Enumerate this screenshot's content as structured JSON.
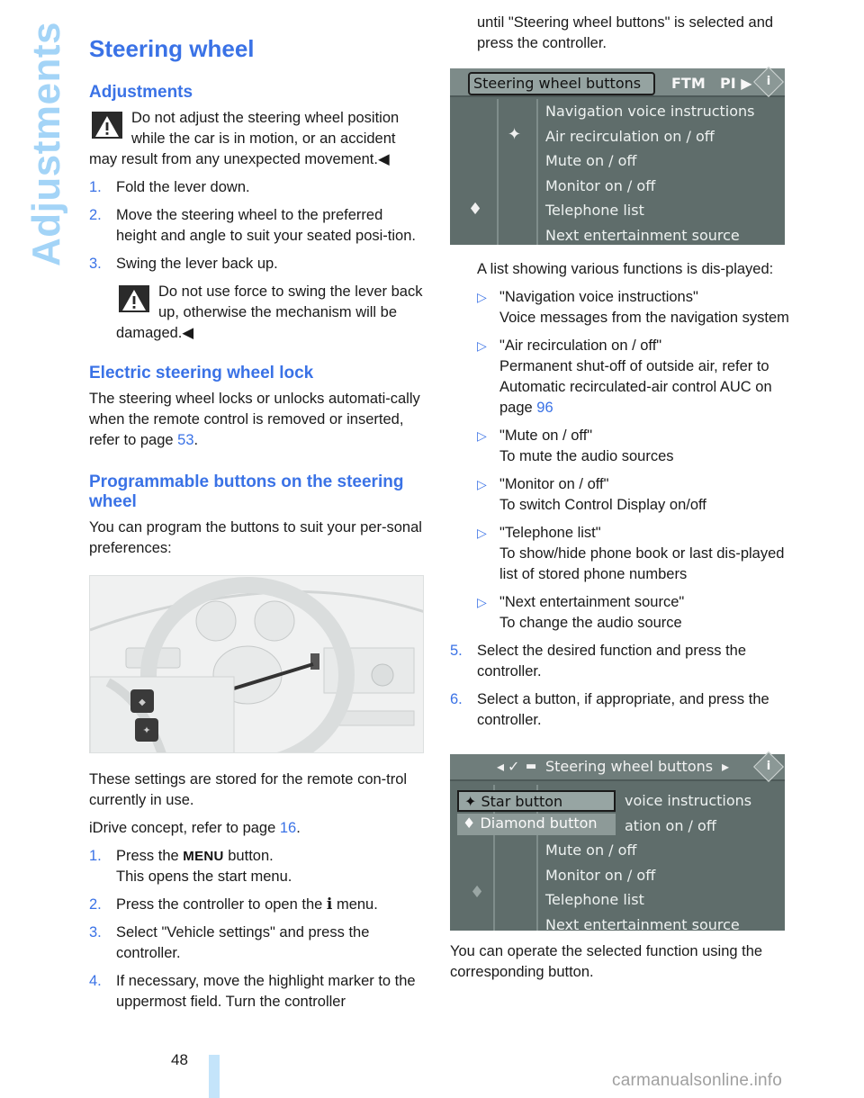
{
  "side_label": "Adjustments",
  "page_number": "48",
  "watermark": "carmanualsonline.info",
  "colors": {
    "accent": "#3a72e6",
    "side_label": "#a3d4f7",
    "page_bar": "#c4e4fa"
  },
  "left": {
    "title": "Steering wheel",
    "adjustments": {
      "heading": "Adjustments",
      "warning": "Do not adjust the steering wheel position while the car is in motion, or an accident may result from any unexpected movement.",
      "end_mark": "◀",
      "steps": [
        {
          "num": "1.",
          "text": "Fold the lever down."
        },
        {
          "num": "2.",
          "text": "Move the steering wheel to the preferred height and angle to suit your seated posi-tion."
        },
        {
          "num": "3.",
          "text": "Swing the lever back up."
        }
      ],
      "warning2": "Do not use force to swing the lever back up, otherwise the mechanism will be damaged."
    },
    "lock": {
      "heading": "Electric steering wheel lock",
      "text": "The steering wheel locks or unlocks automati-cally when the remote control is removed or inserted, refer to page ",
      "page_link": "53",
      "tail": "."
    },
    "programmable": {
      "heading": "Programmable buttons on the steering wheel",
      "intro": "You can program the buttons to suit your per-sonal preferences:",
      "figure_id": "W0416CMA",
      "stored": "These settings are stored for the remote con-trol currently in use.",
      "idrive_text": "iDrive concept, refer to page ",
      "idrive_link": "16",
      "idrive_tail": ".",
      "steps": [
        {
          "num": "1.",
          "pre": "Press the ",
          "keyword": "MENU",
          "post": " button.",
          "line2": "This opens the start menu."
        },
        {
          "num": "2.",
          "pre": "Press the controller to open the ",
          "keyword": "i",
          "post": " menu."
        },
        {
          "num": "3.",
          "text": "Select \"Vehicle settings\" and press the controller."
        },
        {
          "num": "4.",
          "text": "If necessary, move the highlight marker to the uppermost field. Turn the controller"
        }
      ]
    }
  },
  "right": {
    "continuation": "until \"Steering wheel buttons\" is selected and press the controller.",
    "screen1": {
      "active_tab": "Steering wheel buttons",
      "tabs": [
        "FTM",
        "PI"
      ],
      "tab_arrow": "▶",
      "info_icon": "i",
      "items": [
        "Navigation voice instructions",
        "Air recirculation on / off",
        "Mute on / off",
        "Monitor on / off",
        "Telephone list",
        "Next entertainment source"
      ],
      "star_mark": "✦",
      "diamond_mark": "♦"
    },
    "list_intro": "A list showing various functions is dis-played:",
    "functions": [
      {
        "name": "\"Navigation voice instructions\"",
        "desc": "Voice messages from the navigation system"
      },
      {
        "name": "\"Air recirculation on / off\"",
        "desc": "Permanent shut-off of outside air, refer to Automatic recirculated-air control AUC on page ",
        "link": "96"
      },
      {
        "name": "\"Mute on / off\"",
        "desc": "To mute the audio sources"
      },
      {
        "name": "\"Monitor on / off\"",
        "desc": "To switch Control Display on/off"
      },
      {
        "name": "\"Telephone list\"",
        "desc": "To show/hide phone book or last dis-played list of stored phone numbers"
      },
      {
        "name": "\"Next entertainment source\"",
        "desc": "To change the audio source"
      }
    ],
    "bullet_marker": "▷",
    "steps": [
      {
        "num": "5.",
        "text": "Select the desired function and press the controller."
      },
      {
        "num": "6.",
        "text": "Select a button, if appropriate, and press the controller."
      }
    ],
    "screen2": {
      "header": "Steering wheel buttons",
      "header_left_arrow": "◂",
      "header_right_arrow": "▸",
      "check": "✓",
      "popup": [
        {
          "icon": "✦",
          "label": "Star button"
        },
        {
          "icon": "♦",
          "label": "Diamond button"
        }
      ],
      "items_partial": [
        "voice instructions",
        "ation on / off"
      ],
      "items": [
        "Mute on / off",
        "Monitor on / off",
        "Telephone list",
        "Next entertainment source"
      ],
      "diamond_mark": "♦",
      "info_icon": "i"
    },
    "closing": "You can operate the selected function using the corresponding button."
  }
}
